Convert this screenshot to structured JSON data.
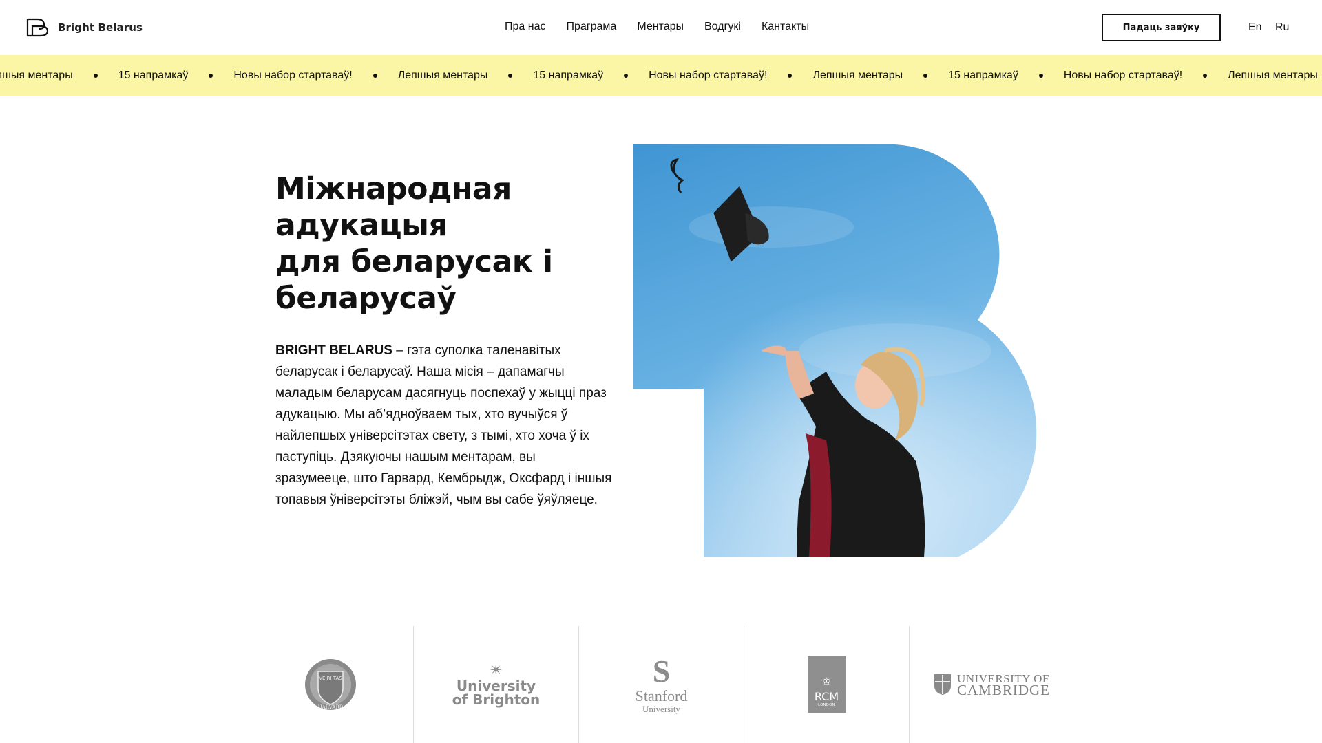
{
  "header": {
    "logo_text": "Bright Belarus",
    "nav": [
      {
        "label": "Пра нас"
      },
      {
        "label": "Праграма"
      },
      {
        "label": "Ментары"
      },
      {
        "label": "Водгукі"
      },
      {
        "label": "Кантакты"
      }
    ],
    "cta_label": "Падаць заяўку",
    "lang_en": "En",
    "lang_ru": "Ru"
  },
  "ticker": {
    "items": [
      "Лепшыя ментары",
      "15 напрамкаў",
      "Новы набор стартаваў!",
      "Лепшыя ментары",
      "15 напрамкаў",
      "Новы набор стартаваў!",
      "Лепшыя ментары",
      "15 напрамкаў",
      "Новы набор стартаваў!",
      "Лепшыя ментары"
    ],
    "background": "#fbf6a6"
  },
  "hero": {
    "title_lines": [
      "Міжнародная",
      "адукацыя",
      "для беларусак і",
      "беларусаў"
    ],
    "lead_bold": "BRIGHT BELARUS",
    "lead_text": " – гэта суполка таленавітых беларусак і беларусаў. Наша місія – дапамагчы маладым беларусам дасягнуць поспехаў у жыцці праз адукацыю. Мы аб’ядноўваем тых, хто вучыўся ў найлепшых універсітэтах свету, з тымі, хто хоча ў іх паступіць. Дзякуючы нашым ментарам, вы зразумееце, што Гарвард, Кембрыдж, Оксфард і іншыя топавыя ўніверсітэты бліжэй, чым вы сабе ўяўляеце."
  },
  "universities": {
    "harvard_motto": "VE RI TAS",
    "harvard_name": "HARVARD",
    "brighton_line1": "University",
    "brighton_line2": "of Brighton",
    "stanford_name": "Stanford",
    "stanford_sub": "University",
    "rcm_name": "RCM",
    "rcm_sub": "LONDON",
    "cambridge_line1": "UNIVERSITY OF",
    "cambridge_line2": "CAMBRIDGE"
  },
  "icons": {
    "logo": "bright-belarus-logo-icon",
    "brighton_star": "compass-star-icon"
  }
}
